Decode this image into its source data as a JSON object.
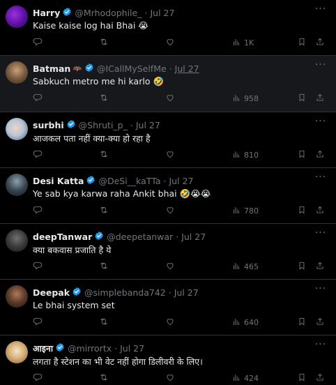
{
  "tweets": [
    {
      "name": "Harry",
      "handle": "@Mrhodophile_",
      "date": "Jul 27",
      "date_underline": false,
      "text": "Kaise kaise log hai Bhai 😭",
      "views": "1K",
      "badge_icon": "verified-badge-icon",
      "extra": "",
      "highlight": false
    },
    {
      "name": "Batman",
      "handle": "@ICallMySelfMe",
      "date": "Jul 27",
      "date_underline": true,
      "text": "Sabkuch metro me hi karlo 🤣",
      "views": "958",
      "badge_icon": "verified-badge-icon",
      "extra": "🦇",
      "highlight": true
    },
    {
      "name": "surbhi",
      "handle": "@Shruti_p_",
      "date": "Jul 27",
      "date_underline": false,
      "text": "आजकल पता नहीं क्या-क्या हो रहा है",
      "views": "810",
      "badge_icon": "verified-badge-icon",
      "extra": "",
      "highlight": false
    },
    {
      "name": "Desi Katta",
      "handle": "@DeSi__kaTTa",
      "date": "Jul 27",
      "date_underline": false,
      "text": "Ye sab kya karwa raha Ankit bhai 🤣😭😭",
      "views": "780",
      "badge_icon": "verified-badge-icon",
      "extra": "",
      "highlight": false
    },
    {
      "name": "deepTanwar",
      "handle": "@deepetanwar",
      "date": "Jul 27",
      "date_underline": false,
      "text": "क्या बकवास प्रजाति है ये",
      "views": "465",
      "badge_icon": "verified-badge-icon",
      "extra": "",
      "highlight": false
    },
    {
      "name": "Deepak",
      "handle": "@simplebanda742",
      "date": "Jul 27",
      "date_underline": false,
      "text": "Le bhai system set",
      "views": "640",
      "badge_icon": "verified-badge-icon",
      "extra": "",
      "highlight": false
    },
    {
      "name": "आइना",
      "handle": "@mirrortx",
      "date": "Jul 27",
      "date_underline": false,
      "text": "लगता है स्टेशन का भी वेट नहीं होगा डिलीवरी के लिए।",
      "views": "424",
      "badge_icon": "verified-badge-icon",
      "extra": "",
      "highlight": false
    }
  ],
  "dot_separator": "·",
  "colors": {
    "background": "#000000",
    "highlight_bg": "#16181c",
    "verified": "#1d9bf0",
    "muted": "#71767b",
    "text": "#e7e9ea"
  },
  "icons": {
    "reply": "reply-icon",
    "retweet": "retweet-icon",
    "like": "like-icon",
    "views": "views-icon",
    "bookmark": "bookmark-icon",
    "share": "share-icon",
    "more": "more-icon"
  }
}
